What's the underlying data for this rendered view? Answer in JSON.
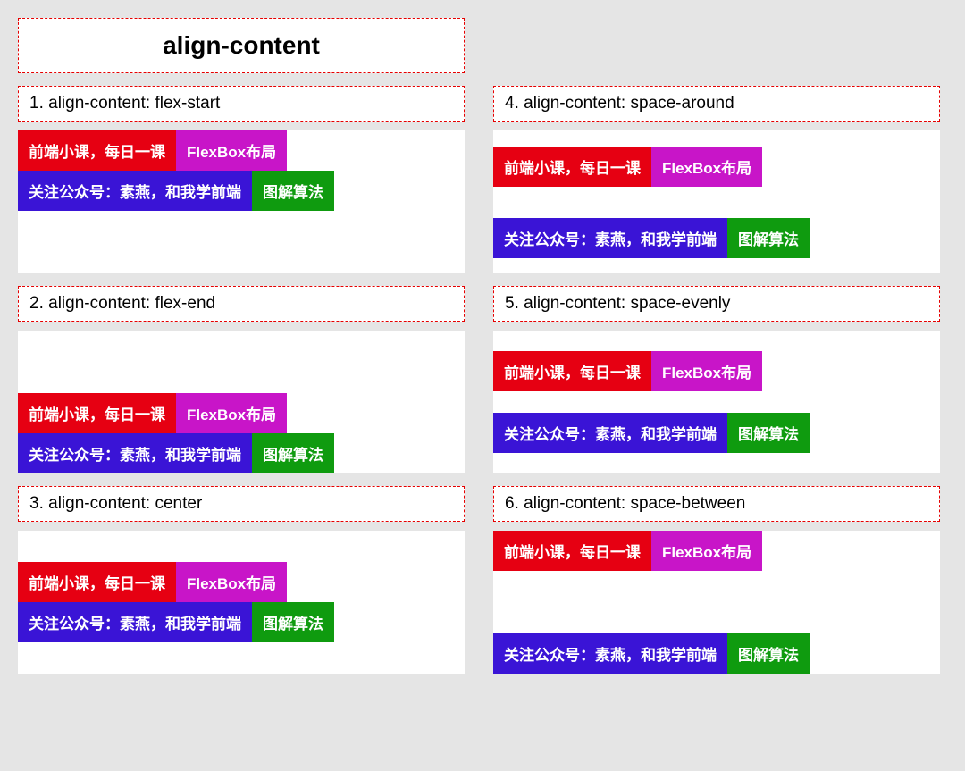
{
  "title": "align-content",
  "items": {
    "a": "前端小课，每日一课",
    "b": "FlexBox布局",
    "c": "关注公众号：素燕，和我学前端",
    "d": "图解算法"
  },
  "examples": [
    {
      "label": "1. align-content: flex-start",
      "mode": "flex-start"
    },
    {
      "label": "2. align-content: flex-end",
      "mode": "flex-end"
    },
    {
      "label": "3. align-content: center",
      "mode": "center"
    },
    {
      "label": "4. align-content: space-around",
      "mode": "space-around"
    },
    {
      "label": "5. align-content: space-evenly",
      "mode": "space-evenly"
    },
    {
      "label": "6. align-content: space-between",
      "mode": "space-between"
    }
  ]
}
